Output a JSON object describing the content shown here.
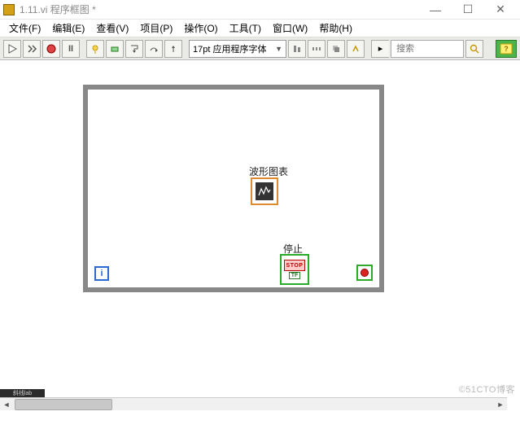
{
  "window": {
    "title": "1.11.vi 程序框图 *",
    "min_symbol": "—",
    "max_symbol": "☐",
    "close_symbol": "✕"
  },
  "menu": {
    "file": "文件(F)",
    "edit": "编辑(E)",
    "view": "查看(V)",
    "project": "项目(P)",
    "operate": "操作(O)",
    "tools": "工具(T)",
    "window": "窗口(W)",
    "help": "帮助(H)"
  },
  "toolbar": {
    "font_label": "17pt 应用程序字体",
    "search_placeholder": "搜索",
    "run_arrow": "▷",
    "pause": "II",
    "help_q": "?"
  },
  "diagram": {
    "chart_label": "波形图表",
    "stop_label": "停止",
    "stop_text": "STOP",
    "tf_text": "TF",
    "iter_char": "i"
  },
  "footer": {
    "watermark": "©51CTO博客",
    "task_text": "斜线lab"
  }
}
